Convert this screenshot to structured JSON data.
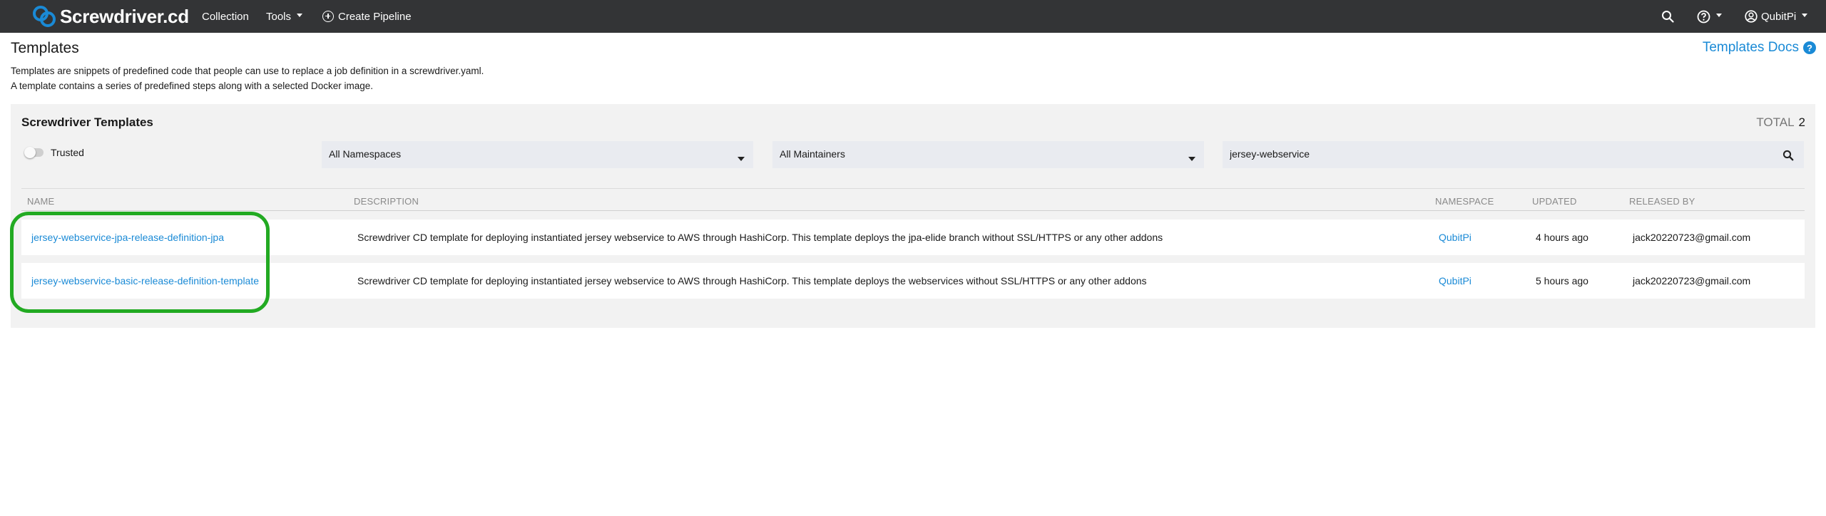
{
  "navbar": {
    "brand": "Screwdriver.cd",
    "collection": "Collection",
    "tools": "Tools",
    "create_pipeline": "Create Pipeline",
    "user": "QubitPi"
  },
  "page": {
    "title": "Templates",
    "docs_link": "Templates Docs",
    "docs_help": "?",
    "intro_line1": "Templates are snippets of predefined code that people can use to replace a job definition in a screwdriver.yaml.",
    "intro_line2": "A template contains a series of predefined steps along with a selected Docker image."
  },
  "panel": {
    "title": "Screwdriver Templates",
    "total_label": "TOTAL",
    "total_value": "2",
    "trusted_label": "Trusted",
    "trusted_on": false,
    "namespace_select": "All Namespaces",
    "maintainer_select": "All Maintainers",
    "search_value": "jersey-webservice"
  },
  "table": {
    "headers": {
      "name": "NAME",
      "description": "DESCRIPTION",
      "namespace": "NAMESPACE",
      "updated": "UPDATED",
      "released_by": "RELEASED BY"
    },
    "rows": [
      {
        "name": "jersey-webservice-jpa-release-definition-jpa",
        "description": "Screwdriver CD template for deploying instantiated jersey webservice to AWS through HashiCorp. This template deploys the jpa-elide branch without SSL/HTTPS or any other addons",
        "namespace": "QubitPi",
        "updated": "4 hours ago",
        "released_by": "jack20220723@gmail.com"
      },
      {
        "name": "jersey-webservice-basic-release-definition-template",
        "description": "Screwdriver CD template for deploying instantiated jersey webservice to AWS through HashiCorp. This template deploys the webservices without SSL/HTTPS or any other addons",
        "namespace": "QubitPi",
        "updated": "5 hours ago",
        "released_by": "jack20220723@gmail.com"
      }
    ]
  },
  "colors": {
    "navbar_bg": "#333436",
    "link": "#1a8ad6",
    "panel_bg": "#f2f2f2",
    "highlight": "#22aa22"
  },
  "icons": [
    "screwdriver-logo-icon",
    "plus-circle-icon",
    "search-icon",
    "question-circle-icon",
    "user-circle-icon",
    "chevron-down-icon"
  ]
}
